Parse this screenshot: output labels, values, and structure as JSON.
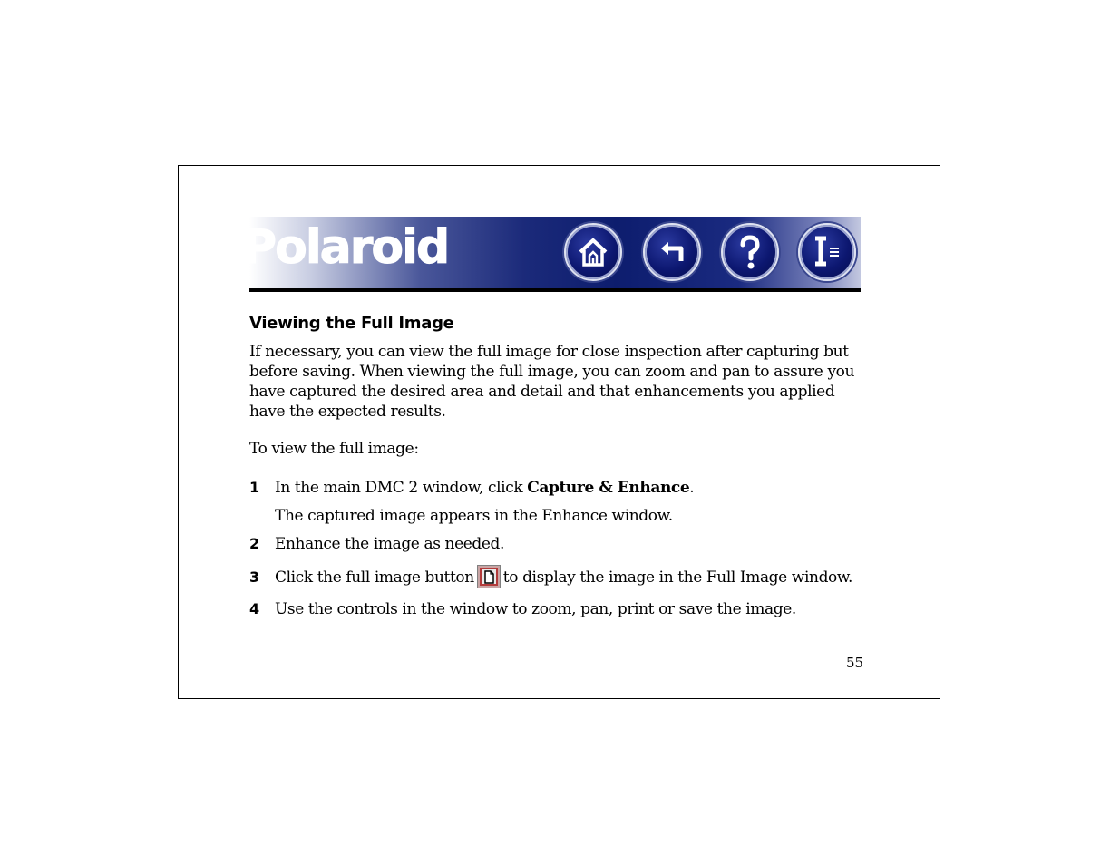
{
  "banner": {
    "logo_text": "Polaroid",
    "buttons": [
      {
        "name": "home",
        "icon": "home-icon"
      },
      {
        "name": "back",
        "icon": "back-arrow-icon"
      },
      {
        "name": "help",
        "icon": "question-mark-icon"
      },
      {
        "name": "index",
        "icon": "index-icon"
      }
    ],
    "colors": {
      "navy": "#0d1d6e",
      "rule": "#000000"
    }
  },
  "section": {
    "heading": "Viewing the Full Image",
    "intro": "If necessary, you can view the full image for close inspection after capturing but before saving. When viewing the full image, you can zoom and pan to assure you have captured the desired area and detail and that enhancements you applied have the expected results.",
    "lead": "To view the full image:",
    "steps": [
      {
        "num": "1",
        "before": "In the main DMC 2 window, click ",
        "bold": "Capture & Enhance",
        "after": "."
      },
      {
        "num": "2",
        "text": "Enhance the image as needed."
      },
      {
        "num": "3",
        "before": "Click the full image button",
        "after": "to display the image in the Full Image window.",
        "icon": "full-image-icon"
      },
      {
        "num": "4",
        "text": "Use the controls in the window to zoom, pan, print or save the image."
      }
    ],
    "step1_note": "The captured image appears in the Enhance window."
  },
  "footer": {
    "page_number": "55"
  }
}
